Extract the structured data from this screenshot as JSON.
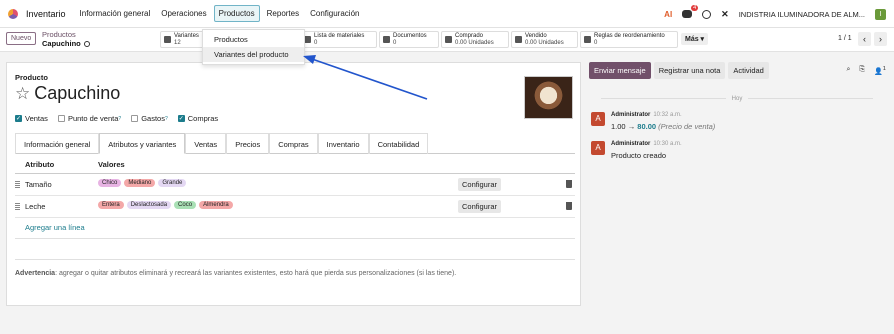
{
  "topnav": {
    "app_name": "Inventario",
    "menu": [
      "Información general",
      "Operaciones",
      "Productos",
      "Reportes",
      "Configuración"
    ],
    "ai_label": "AI",
    "chat_badge": "4",
    "tools_icon": "✕",
    "company": "INDISTRIA ILUMINADORA DE ALM...",
    "user_initial": "I"
  },
  "control": {
    "new_button": "Nuevo",
    "breadcrumb_parent": "Productos",
    "breadcrumb_current": "Capuchino",
    "stats": [
      {
        "label": "Variantes",
        "value": "12"
      },
      {
        "label": "Lista de materiales",
        "value": "0"
      },
      {
        "label": "Documentos",
        "value": "0"
      },
      {
        "label": "Comprado",
        "value": "0.00 Unidades"
      },
      {
        "label": "Vendido",
        "value": "0.00 Unidades"
      },
      {
        "label": "Reglas de reordenamiento",
        "value": "0"
      }
    ],
    "more": "Más ▾",
    "pager": "1 / 1",
    "prev": "‹",
    "next": "›"
  },
  "dropdown": {
    "items": [
      "Productos",
      "Variantes del producto"
    ]
  },
  "form": {
    "product_type_label": "Producto",
    "product_name": "Capuchino",
    "star_icon": "☆",
    "checkboxes": [
      {
        "label": "Ventas",
        "checked": true,
        "sup": ""
      },
      {
        "label": "Punto de venta",
        "checked": false,
        "sup": "?"
      },
      {
        "label": "Gastos",
        "checked": false,
        "sup": "?"
      },
      {
        "label": "Compras",
        "checked": true,
        "sup": ""
      }
    ],
    "tabs": [
      "Información general",
      "Atributos y variantes",
      "Ventas",
      "Precios",
      "Compras",
      "Inventario",
      "Contabilidad"
    ],
    "active_tab": "Atributos y variantes",
    "table_headers": {
      "attribute": "Atributo",
      "values": "Valores"
    },
    "rows": [
      {
        "attribute": "Tamaño",
        "values": [
          {
            "text": "Chico",
            "color": "#e7b3e3"
          },
          {
            "text": "Mediano",
            "color": "#f4a8a8"
          },
          {
            "text": "Grande",
            "color": "#e4d8f3"
          }
        ],
        "configure": "Configurar"
      },
      {
        "attribute": "Leche",
        "values": [
          {
            "text": "Entera",
            "color": "#f4a8a8"
          },
          {
            "text": "Deslactosada",
            "color": "#e4d8f3"
          },
          {
            "text": "Coco",
            "color": "#a9e0b5"
          },
          {
            "text": "Almendra",
            "color": "#f4a8a8"
          }
        ],
        "configure": "Configurar"
      }
    ],
    "add_line": "Agregar una línea",
    "warning_label": "Advertencia",
    "warning_text": ": agregar o quitar atributos eliminará y recreará las variantes existentes, esto hará que pierda sus personalizaciones (si las tiene)."
  },
  "chatter": {
    "buttons": [
      "Enviar mensaje",
      "Registrar una nota",
      "Actividad"
    ],
    "followers_count": "1",
    "date_separator": "Hoy",
    "messages": [
      {
        "author": "Administrator",
        "time": "10:32 a.m.",
        "old": "1.00",
        "arrow": "→",
        "new": "80.00",
        "field": "(Precio de venta)",
        "initial": "A"
      },
      {
        "author": "Administrator",
        "time": "10:30 a.m.",
        "body": "Producto creado",
        "initial": "A"
      }
    ]
  },
  "colors": {
    "brand": "#71506a",
    "accent": "#1c7c8c",
    "arrow": "#2255cc"
  }
}
